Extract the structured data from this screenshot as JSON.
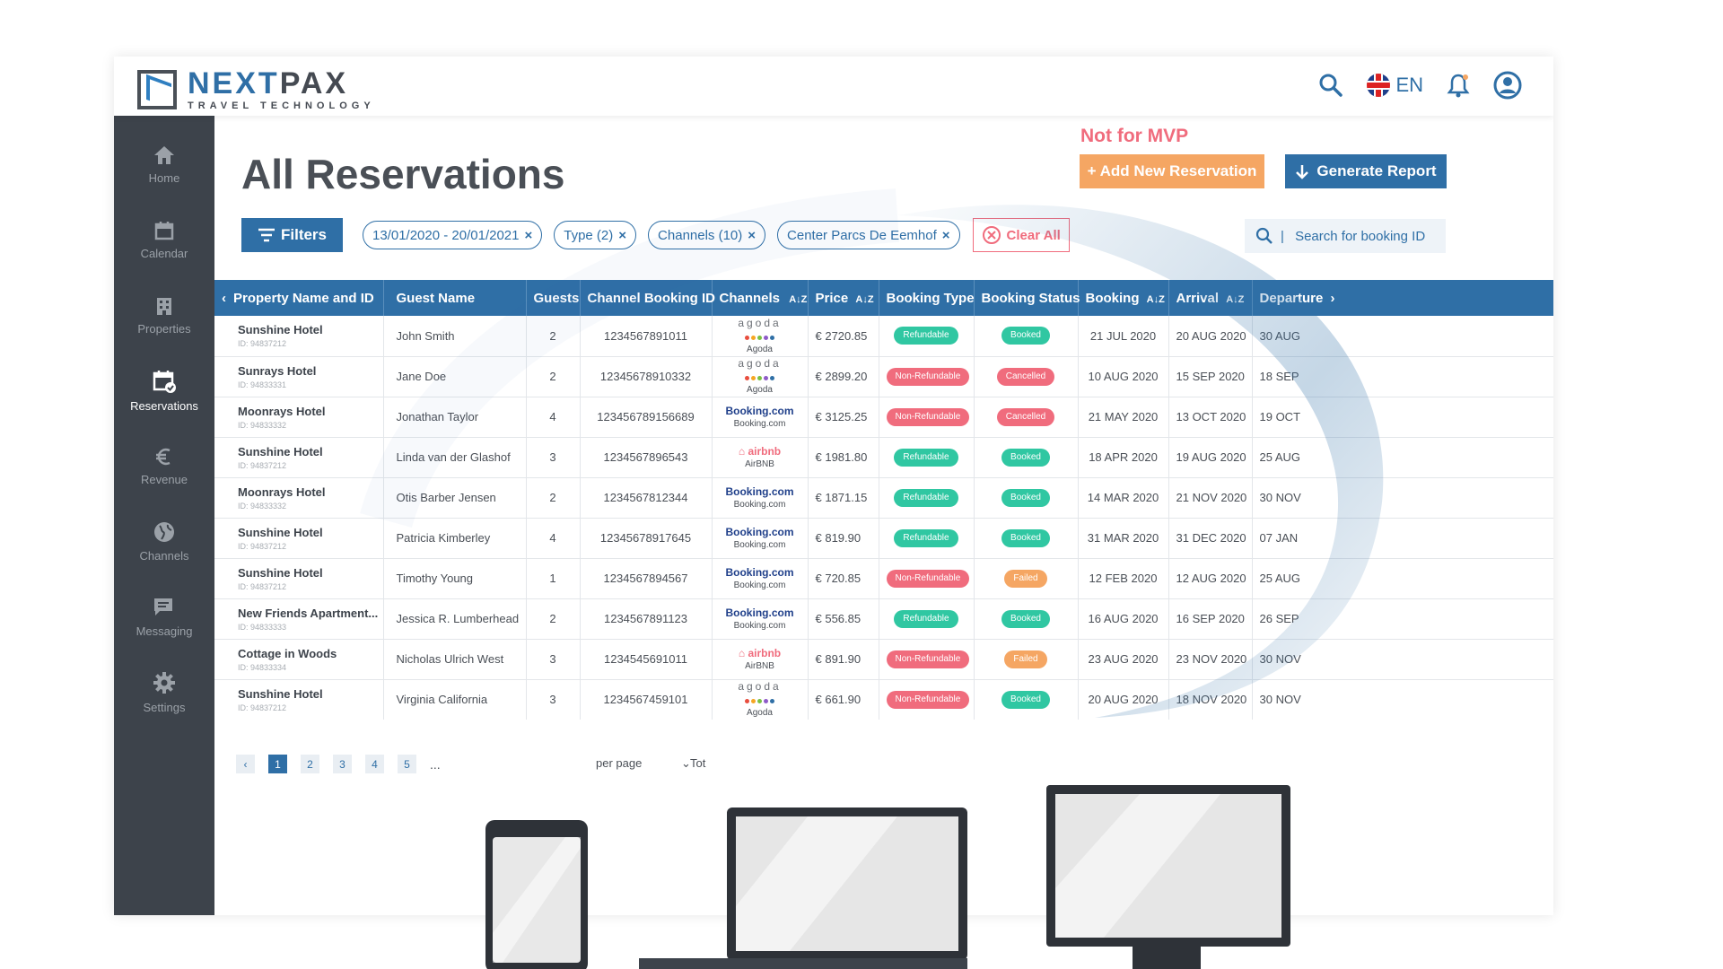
{
  "brand": {
    "name_blue": "NEXT",
    "name_dark": "PAX",
    "subtitle": "TRAVEL TECHNOLOGY"
  },
  "header": {
    "language": "EN",
    "icons": [
      "search-icon",
      "uk-flag-icon",
      "bell-icon",
      "user-avatar-icon"
    ]
  },
  "sidebar": {
    "items": [
      {
        "label": "Home",
        "icon": "home-icon"
      },
      {
        "label": "Calendar",
        "icon": "calendar-icon"
      },
      {
        "label": "Properties",
        "icon": "building-icon"
      },
      {
        "label": "Reservations",
        "icon": "calendar-check-icon",
        "active": true
      },
      {
        "label": "Revenue",
        "icon": "euro-icon"
      },
      {
        "label": "Channels",
        "icon": "globe-icon"
      },
      {
        "label": "Messaging",
        "icon": "chat-icon"
      },
      {
        "label": "Settings",
        "icon": "gear-icon"
      }
    ]
  },
  "page": {
    "title": "All Reservations",
    "mvp_note": "Not for MVP",
    "add_button": "+ Add New Reservation",
    "report_button": "Generate Report"
  },
  "filters": {
    "button": "Filters",
    "chips": [
      "13/01/2020 - 20/01/2021",
      "Type (2)",
      "Channels (10)",
      "Center Parcs De Eemhof"
    ],
    "clear_all": "Clear All",
    "search_placeholder": "Search for booking ID"
  },
  "table": {
    "columns": [
      "Property Name and ID",
      "Guest Name",
      "Guests",
      "Channel Booking ID",
      "Channels",
      "Price",
      "Booking Type",
      "Booking Status",
      "Booking",
      "Arrival",
      "Departure"
    ],
    "rows": [
      {
        "property": "Sunshine Hotel",
        "id": "ID: 94837212",
        "guest": "John Smith",
        "guests": "2",
        "booking_id": "1234567891011",
        "channel": "agoda",
        "channel_name": "Agoda",
        "price": "€ 2720.85",
        "type": "Refundable",
        "status": "Booked",
        "booking": "21 JUL 2020",
        "arrival": "20 AUG 2020",
        "departure": "30 AUG"
      },
      {
        "property": "Sunrays Hotel",
        "id": "ID: 94833331",
        "guest": "Jane Doe",
        "guests": "2",
        "booking_id": "12345678910332",
        "channel": "agoda",
        "channel_name": "Agoda",
        "price": "€ 2899.20",
        "type": "Non-Refundable",
        "status": "Cancelled",
        "booking": "10 AUG 2020",
        "arrival": "15 SEP 2020",
        "departure": "18 SEP"
      },
      {
        "property": "Moonrays Hotel",
        "id": "ID: 94833332",
        "guest": "Jonathan Taylor",
        "guests": "4",
        "booking_id": "123456789156689",
        "channel": "Booking.com",
        "channel_name": "Booking.com",
        "price": "€ 3125.25",
        "type": "Non-Refundable",
        "status": "Cancelled",
        "booking": "21 MAY 2020",
        "arrival": "13 OCT 2020",
        "departure": "19 OCT"
      },
      {
        "property": "Sunshine Hotel",
        "id": "ID: 94837212",
        "guest": "Linda van der Glashof",
        "guests": "3",
        "booking_id": "1234567896543",
        "channel": "airbnb",
        "channel_name": "AirBNB",
        "price": "€ 1981.80",
        "type": "Refundable",
        "status": "Booked",
        "booking": "18 APR 2020",
        "arrival": "19 AUG 2020",
        "departure": "25 AUG"
      },
      {
        "property": "Moonrays Hotel",
        "id": "ID: 94833332",
        "guest": "Otis Barber Jensen",
        "guests": "2",
        "booking_id": "1234567812344",
        "channel": "Booking.com",
        "channel_name": "Booking.com",
        "price": "€ 1871.15",
        "type": "Refundable",
        "status": "Booked",
        "booking": "14 MAR 2020",
        "arrival": "21 NOV 2020",
        "departure": "30 NOV"
      },
      {
        "property": "Sunshine Hotel",
        "id": "ID: 94837212",
        "guest": "Patricia Kimberley",
        "guests": "4",
        "booking_id": "12345678917645",
        "channel": "Booking.com",
        "channel_name": "Booking.com",
        "price": "€ 819.90",
        "type": "Refundable",
        "status": "Booked",
        "booking": "31 MAR 2020",
        "arrival": "31 DEC 2020",
        "departure": "07 JAN"
      },
      {
        "property": "Sunshine Hotel",
        "id": "ID: 94837212",
        "guest": "Timothy Young",
        "guests": "1",
        "booking_id": "1234567894567",
        "channel": "Booking.com",
        "channel_name": "Booking.com",
        "price": "€ 720.85",
        "type": "Non-Refundable",
        "status": "Failed",
        "booking": "12 FEB 2020",
        "arrival": "12 AUG 2020",
        "departure": "25 AUG"
      },
      {
        "property": "New Friends Apartment...",
        "id": "ID: 94833333",
        "guest": "Jessica R. Lumberhead",
        "guests": "2",
        "booking_id": "1234567891123",
        "channel": "Booking.com",
        "channel_name": "Booking.com",
        "price": "€ 556.85",
        "type": "Refundable",
        "status": "Booked",
        "booking": "16 AUG 2020",
        "arrival": "16 SEP 2020",
        "departure": "26 SEP"
      },
      {
        "property": "Cottage in Woods",
        "id": "ID: 94833334",
        "guest": "Nicholas Ulrich West",
        "guests": "3",
        "booking_id": "1234545691011",
        "channel": "airbnb",
        "channel_name": "AirBNB",
        "price": "€ 891.90",
        "type": "Non-Refundable",
        "status": "Failed",
        "booking": "23 AUG 2020",
        "arrival": "23 NOV 2020",
        "departure": "30 NOV"
      },
      {
        "property": "Sunshine Hotel",
        "id": "ID: 94837212",
        "guest": "Virginia California",
        "guests": "3",
        "booking_id": "1234567459101",
        "channel": "agoda",
        "channel_name": "Agoda",
        "price": "€ 661.90",
        "type": "Non-Refundable",
        "status": "Booked",
        "booking": "20 AUG 2020",
        "arrival": "18 NOV 2020",
        "departure": "30 NOV"
      }
    ]
  },
  "pagination": {
    "pages": [
      "1",
      "2",
      "3",
      "4",
      "5"
    ],
    "active": "1",
    "ellipsis": "...",
    "per_page_label": "per page",
    "total_label": "Tot"
  },
  "colors": {
    "primary": "#2f6fa6",
    "sidebar": "#3d434b",
    "orange": "#f5a663",
    "red": "#f06c7d",
    "green": "#30c7a2"
  }
}
